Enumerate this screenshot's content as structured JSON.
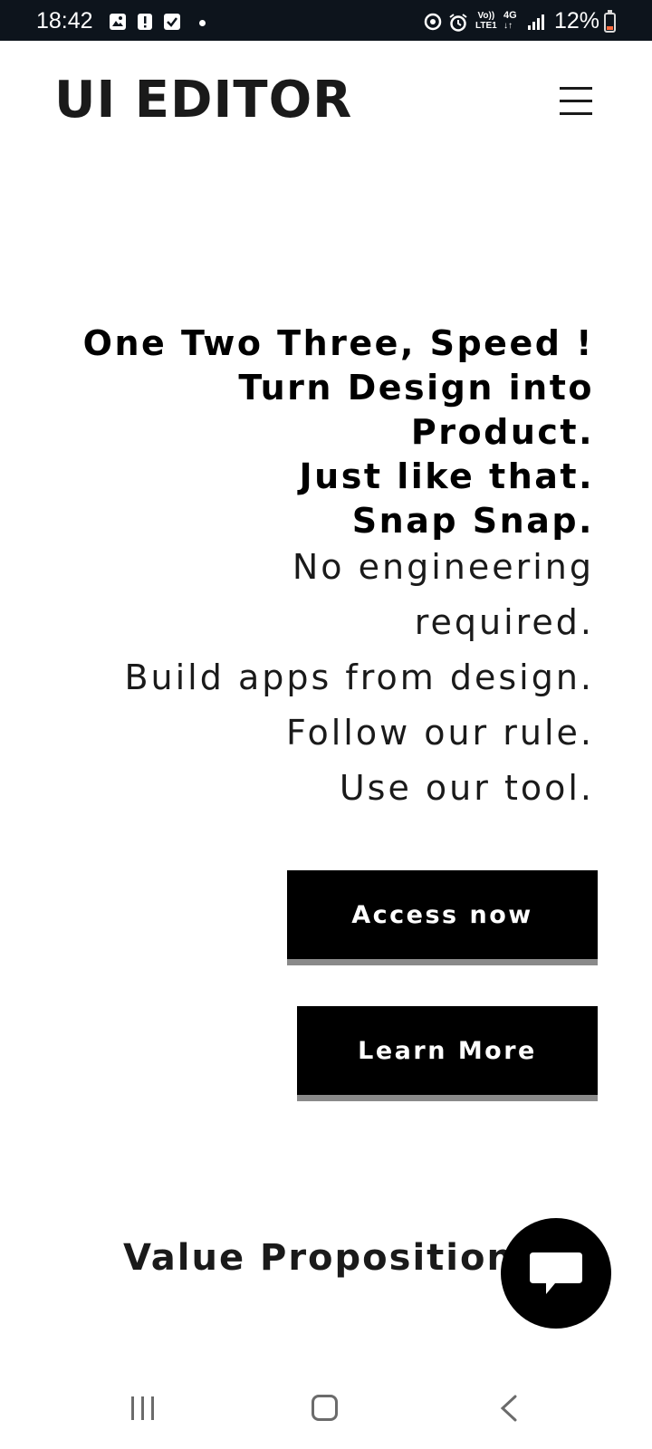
{
  "status_bar": {
    "time": "18:42",
    "icons": [
      "gallery-icon",
      "alert-icon",
      "checkbox-icon",
      "dot-icon",
      "data-saver-icon",
      "alarm-icon",
      "volte-icon",
      "4g-icon",
      "signal-icon",
      "battery-icon"
    ],
    "volte_line1": "Vo))",
    "volte_line2": "LTE1",
    "network": "4G",
    "battery_percent": "12%",
    "battery_level": 0.12,
    "background": "#0d141c",
    "battery_color": "#ff6a3d"
  },
  "header": {
    "logo": "UI EDITOR",
    "menu_icon": "hamburger-menu-icon"
  },
  "hero": {
    "bold_lines": [
      "One Two Three, Speed !",
      "Turn Design into",
      "Product.",
      "Just like that.",
      "Snap Snap."
    ],
    "light_lines": [
      "No engineering",
      "required.",
      "Build apps from design.",
      "Follow our rule.",
      "Use our tool."
    ],
    "primary_button": "Access now",
    "secondary_button": "Learn More"
  },
  "section": {
    "title": "Value Proposition"
  },
  "chat": {
    "icon": "chat-bubble-icon"
  },
  "nav_bar": {
    "icons": [
      "recent-apps-icon",
      "home-icon",
      "back-icon"
    ]
  },
  "colors": {
    "button_bg": "#000000",
    "button_shadow": "#8a8a8a",
    "text": "#1a1a1a"
  }
}
